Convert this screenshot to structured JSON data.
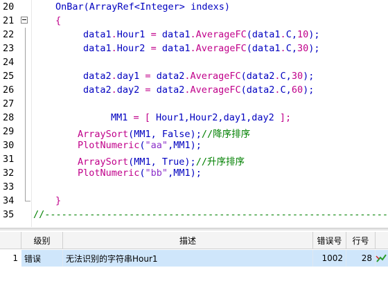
{
  "editor": {
    "lines": [
      {
        "num": "20",
        "tokens": [
          {
            "t": "OnBar(ArrayRef<Integer> indexs)",
            "c": "c-kw"
          }
        ]
      },
      {
        "num": "21",
        "tokens": [
          {
            "t": "{",
            "c": "c-br"
          }
        ]
      },
      {
        "num": "22",
        "tokens": [
          {
            "t": "data1",
            "c": "c-kw"
          },
          {
            "t": ".",
            "c": "c-dot"
          },
          {
            "t": "Hour1 ",
            "c": "c-kw"
          },
          {
            "t": "= ",
            "c": "c-op"
          },
          {
            "t": "data1",
            "c": "c-kw"
          },
          {
            "t": ".",
            "c": "c-dot"
          },
          {
            "t": "AverageFC",
            "c": "c-fn"
          },
          {
            "t": "(data1",
            "c": "c-kw"
          },
          {
            "t": ".",
            "c": "c-dot"
          },
          {
            "t": "C,",
            "c": "c-kw"
          },
          {
            "t": "10",
            "c": "c-num"
          },
          {
            "t": ");",
            "c": "c-kw"
          }
        ]
      },
      {
        "num": "23",
        "tokens": [
          {
            "t": "data1",
            "c": "c-kw"
          },
          {
            "t": ".",
            "c": "c-dot"
          },
          {
            "t": "Hour2 ",
            "c": "c-kw"
          },
          {
            "t": "= ",
            "c": "c-op"
          },
          {
            "t": "data1",
            "c": "c-kw"
          },
          {
            "t": ".",
            "c": "c-dot"
          },
          {
            "t": "AverageFC",
            "c": "c-fn"
          },
          {
            "t": "(data1",
            "c": "c-kw"
          },
          {
            "t": ".",
            "c": "c-dot"
          },
          {
            "t": "C,",
            "c": "c-kw"
          },
          {
            "t": "30",
            "c": "c-num"
          },
          {
            "t": ");",
            "c": "c-kw"
          }
        ]
      },
      {
        "num": "24",
        "tokens": []
      },
      {
        "num": "25",
        "tokens": [
          {
            "t": "data2",
            "c": "c-kw"
          },
          {
            "t": ".",
            "c": "c-dot"
          },
          {
            "t": "day1 ",
            "c": "c-kw"
          },
          {
            "t": "= ",
            "c": "c-op"
          },
          {
            "t": "data2",
            "c": "c-kw"
          },
          {
            "t": ".",
            "c": "c-dot"
          },
          {
            "t": "AverageFC",
            "c": "c-fn"
          },
          {
            "t": "(data2",
            "c": "c-kw"
          },
          {
            "t": ".",
            "c": "c-dot"
          },
          {
            "t": "C,",
            "c": "c-kw"
          },
          {
            "t": "30",
            "c": "c-num"
          },
          {
            "t": ");",
            "c": "c-kw"
          }
        ]
      },
      {
        "num": "26",
        "tokens": [
          {
            "t": "data2",
            "c": "c-kw"
          },
          {
            "t": ".",
            "c": "c-dot"
          },
          {
            "t": "day2 ",
            "c": "c-kw"
          },
          {
            "t": "= ",
            "c": "c-op"
          },
          {
            "t": "data2",
            "c": "c-kw"
          },
          {
            "t": ".",
            "c": "c-dot"
          },
          {
            "t": "AverageFC",
            "c": "c-fn"
          },
          {
            "t": "(data2",
            "c": "c-kw"
          },
          {
            "t": ".",
            "c": "c-dot"
          },
          {
            "t": "C,",
            "c": "c-kw"
          },
          {
            "t": "60",
            "c": "c-num"
          },
          {
            "t": ");",
            "c": "c-kw"
          }
        ]
      },
      {
        "num": "27",
        "tokens": []
      },
      {
        "num": "28",
        "tokens": [
          {
            "t": "MM1 ",
            "c": "c-kw"
          },
          {
            "t": "= [ ",
            "c": "c-op"
          },
          {
            "t": "Hour1,Hour2,day1,day2 ",
            "c": "c-kw"
          },
          {
            "t": "];",
            "c": "c-op"
          }
        ]
      },
      {
        "num": "29",
        "tokens": [
          {
            "t": "ArraySort",
            "c": "c-fn"
          },
          {
            "t": "(MM1, False);",
            "c": "c-kw"
          },
          {
            "t": "//降序排序",
            "c": "c-cm"
          }
        ]
      },
      {
        "num": "30",
        "tokens": [
          {
            "t": "PlotNumeric",
            "c": "c-fn"
          },
          {
            "t": "(",
            "c": "c-kw"
          },
          {
            "t": "\"aa\"",
            "c": "c-str"
          },
          {
            "t": ",MM1);",
            "c": "c-kw"
          }
        ]
      },
      {
        "num": "31",
        "tokens": [
          {
            "t": "ArraySort",
            "c": "c-fn"
          },
          {
            "t": "(MM1, True);",
            "c": "c-kw"
          },
          {
            "t": "//升序排序",
            "c": "c-cm"
          }
        ]
      },
      {
        "num": "32",
        "tokens": [
          {
            "t": "PlotNumeric",
            "c": "c-fn"
          },
          {
            "t": "(",
            "c": "c-kw"
          },
          {
            "t": "\"bb\"",
            "c": "c-str"
          },
          {
            "t": ",MM1);",
            "c": "c-kw"
          }
        ]
      },
      {
        "num": "33",
        "tokens": []
      },
      {
        "num": "34",
        "tokens": [
          {
            "t": "}",
            "c": "c-br"
          }
        ]
      },
      {
        "num": "35",
        "tokens": [
          {
            "t": "//-----------------------------------------------------------------------",
            "c": "c-cm"
          }
        ]
      }
    ]
  },
  "errors": {
    "headers": {
      "level": "级别",
      "desc": "描述",
      "code": "错误号",
      "line": "行号"
    },
    "rows": [
      {
        "index": "1",
        "level": "错误",
        "desc": "无法识别的字符串Hour1",
        "code": "1002",
        "line": "28"
      }
    ]
  },
  "colors": {
    "selected_row": "#cfe6fb",
    "keyword": "#0000c0",
    "function": "#c0008a",
    "comment": "#008000",
    "string": "#8b2fc9"
  }
}
